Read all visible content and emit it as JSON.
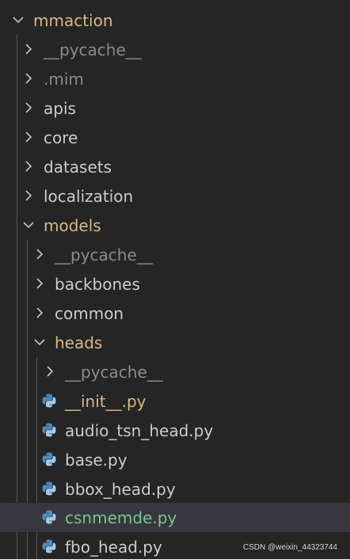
{
  "colors": {
    "background": "#252526",
    "text_default": "#cccccc",
    "text_dim": "#8b8b8b",
    "text_modified": "#d7ba7d",
    "text_added": "#73c991",
    "selected_row": "#37373d",
    "guide": "#585858",
    "python_blue": "#4b8bbe",
    "python_light": "#a8c9e3"
  },
  "icons": {
    "collapsed": "chevron-right-icon",
    "expanded": "chevron-down-icon",
    "python_file": "python-file-icon"
  },
  "tree": {
    "root": {
      "label": "mmaction"
    },
    "items": [
      {
        "label": "__pycache__"
      },
      {
        "label": ".mim"
      },
      {
        "label": "apis"
      },
      {
        "label": "core"
      },
      {
        "label": "datasets"
      },
      {
        "label": "localization"
      },
      {
        "label": "models"
      },
      {
        "label": "__pycache__"
      },
      {
        "label": "backbones"
      },
      {
        "label": "common"
      },
      {
        "label": "heads"
      },
      {
        "label": "__pycache__"
      },
      {
        "label": "__init__.py"
      },
      {
        "label": "audio_tsn_head.py"
      },
      {
        "label": "base.py"
      },
      {
        "label": "bbox_head.py"
      },
      {
        "label": "csnmemde.py"
      },
      {
        "label": "fbo_head.py"
      }
    ]
  },
  "watermark": "CSDN @weixin_44323744"
}
